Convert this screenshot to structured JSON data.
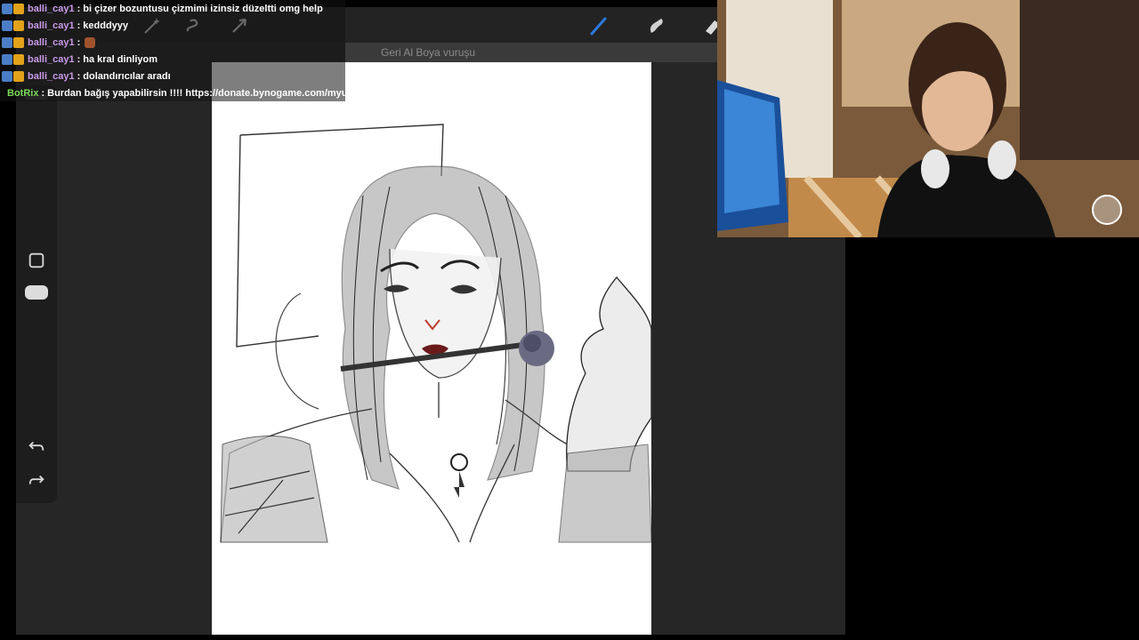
{
  "toolbar": {
    "undo_toast": "Geri Al Boya vuruşu",
    "icons": [
      "wrench-icon",
      "magic-wand-icon",
      "selection-icon",
      "move-arrow-icon",
      "brush-icon",
      "smudge-icon",
      "eraser-icon"
    ]
  },
  "sidebar": {
    "icons": [
      "square-modify-icon",
      "opacity-slider-handle",
      "undo-arrow-icon",
      "redo-arrow-icon"
    ]
  },
  "chat": {
    "messages": [
      {
        "user": "balli_cay1",
        "text": "bi çizer bozuntusu çizmimi izinsiz düzeltti omg help"
      },
      {
        "user": "balli_cay1",
        "text": "kedddyyy"
      },
      {
        "user": "balli_cay1",
        "text": ""
      },
      {
        "user": "balli_cay1",
        "text": "ha kral dinliyom"
      },
      {
        "user": "balli_cay1",
        "text": "dolandırıcılar aradı"
      },
      {
        "user": "BotRix",
        "text": "Burdan bağış yapabilirsin !!!! https://donate.bynogame.com/myuraart"
      }
    ]
  },
  "colors": {
    "app_bg": "#262626",
    "accent_brush": "#2a7be0",
    "chat_user": "#c99ae8",
    "bot_user": "#7ad957"
  }
}
